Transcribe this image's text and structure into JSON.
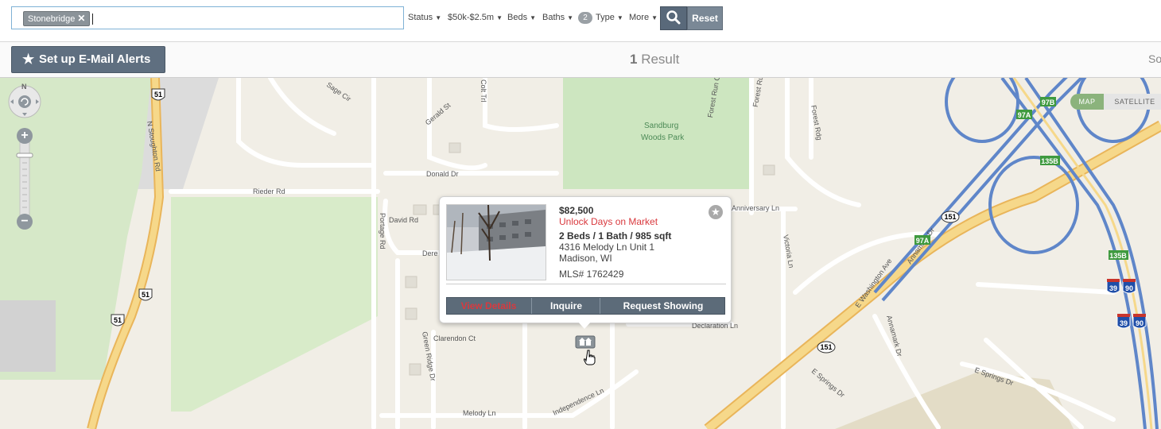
{
  "search": {
    "tag": "Stonebridge",
    "tag_remove": "✕",
    "value": ""
  },
  "filters": {
    "status": "Status",
    "price": "$50k-$2.5m",
    "beds": "Beds",
    "baths": "Baths",
    "type_count": "2",
    "type": "Type",
    "more": "More",
    "arrow": "▼"
  },
  "buttons": {
    "reset": "Reset",
    "email_alerts": "Set up E-Mail Alerts"
  },
  "results": {
    "count": "1",
    "label": "Result",
    "sort_partial": "So"
  },
  "map_type": {
    "map": "MAP",
    "satellite": "SATELLITE"
  },
  "nav": {
    "north": "N",
    "zoom_in": "+",
    "zoom_out": "−"
  },
  "listing": {
    "price": "$82,500",
    "unlock": "Unlock Days on Market",
    "details": "2 Beds / 1 Bath / 985 sqft",
    "address_line1": "4316 Melody Ln Unit 1",
    "address_line2": "Madison, WI",
    "mls": "MLS# 1762429",
    "view_details": "View Details",
    "inquire": "Inquire",
    "request_showing": "Request Showing"
  },
  "map_labels": {
    "park": [
      "Sandburg",
      "Woods Park"
    ],
    "roads": [
      "N Stoughton Rd",
      "Rieder Rd",
      "Donald Dr",
      "David Rd",
      "Portage Rd",
      "Dere",
      "Sage Cir",
      "Gerald St",
      "Green Ridge Dr",
      "Clarendon Ct",
      "Melody Ln",
      "Independence Ln",
      "Declaration Ln",
      "Anniversary Ln",
      "Victoria Ln",
      "Forest Run Ct",
      "Forest Run Dr",
      "Forest Rdg",
      "Annamark Dr",
      "E Washington Ave",
      "E Springs Dr",
      "Colt Trl"
    ],
    "shields_us": [
      "51",
      "51",
      "51"
    ],
    "shields_state": [
      "151",
      "151"
    ],
    "exits": [
      "97A",
      "97B",
      "135B",
      "97A",
      "135B"
    ],
    "interstates": [
      "39",
      "90",
      "39",
      "90"
    ]
  }
}
